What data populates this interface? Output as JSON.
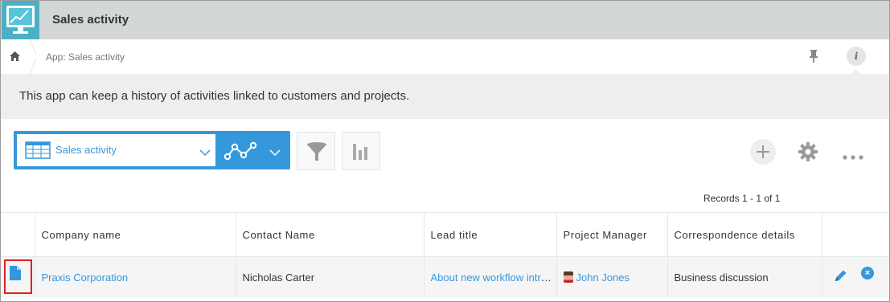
{
  "header": {
    "app_title": "Sales activity",
    "app_icon": "monitor-chart-icon",
    "app_icon_color": "#49b0c6"
  },
  "breadcrumb": {
    "home_icon": "home-icon",
    "text": "App: Sales activity",
    "pin_icon": "pin-icon",
    "info_icon": "info-icon",
    "info_glyph": "i"
  },
  "description": "This app can keep a history of activities linked to customers and projects.",
  "toolbar": {
    "view_name": "Sales activity",
    "view_icon": "table-view-icon",
    "graph_icon": "line-graph-icon",
    "filter_icon": "funnel-icon",
    "chart_icon": "bar-chart-icon",
    "add_icon": "plus-icon",
    "settings_icon": "gear-icon",
    "more_icon": "ellipsis-icon",
    "accent_color": "#3498db"
  },
  "records_count": "Records 1 - 1 of 1",
  "table": {
    "columns": [
      "Company name",
      "Contact Name",
      "Lead title",
      "Project Manager",
      "Correspondence details"
    ],
    "rows": [
      {
        "company": "Praxis Corporation",
        "contact": "Nicholas Carter",
        "lead": "About new workflow introduction",
        "manager": "John Jones",
        "details": "Business discussion"
      }
    ]
  },
  "row_actions": {
    "edit_icon": "pencil-icon",
    "delete_icon": "close-circle-icon",
    "delete_glyph": "×"
  }
}
